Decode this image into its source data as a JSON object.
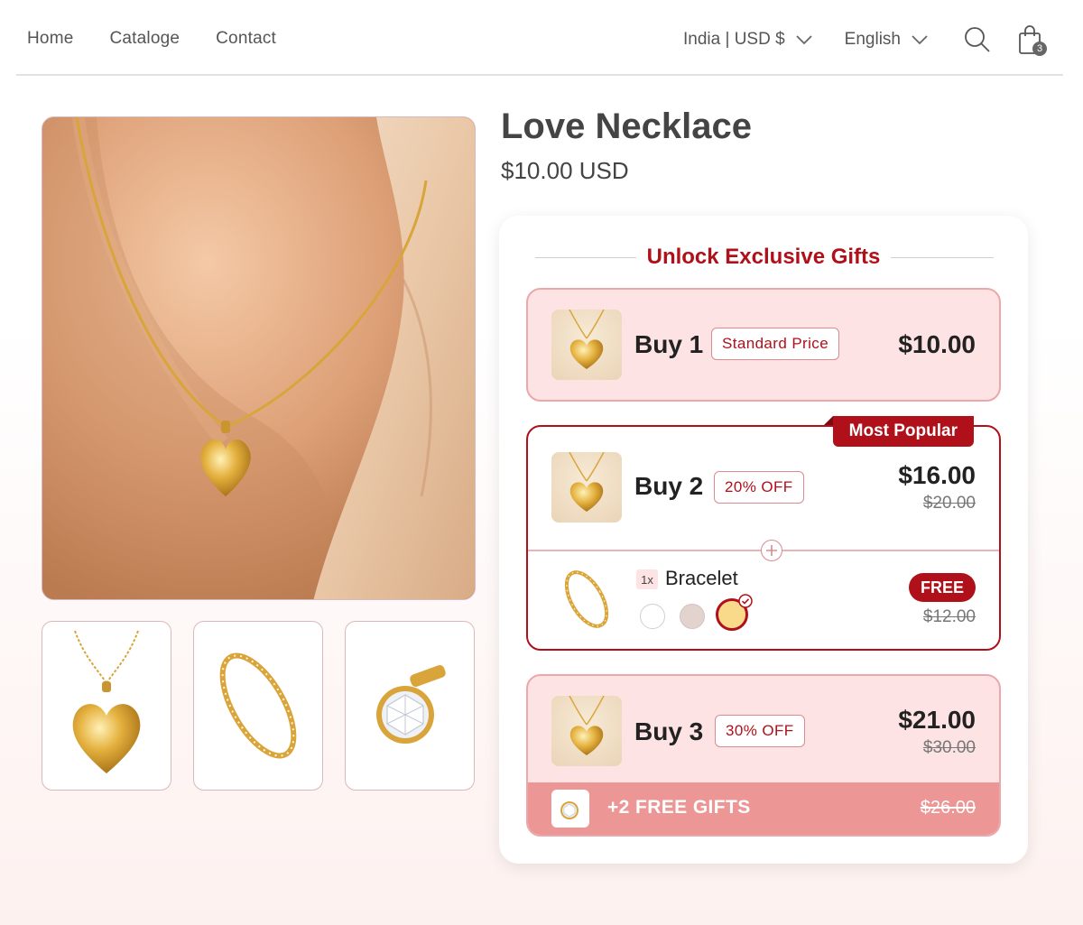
{
  "nav": {
    "items": [
      "Home",
      "Cataloge",
      "Contact"
    ]
  },
  "header": {
    "region": "India | USD $",
    "language": "English",
    "cart_count": "3",
    "icons": {
      "search": "search-icon",
      "cart": "shopping-bag-icon",
      "chevron": "chevron-down-icon"
    }
  },
  "product": {
    "title": "Love Necklace",
    "price": "$10.00 USD"
  },
  "bundle": {
    "heading": "Unlock Exclusive Gifts",
    "options": [
      {
        "label": "Buy 1",
        "tag": "Standard Price",
        "price": "$10.00"
      },
      {
        "label": "Buy 2",
        "tag": "20% OFF",
        "price": "$16.00",
        "old_price": "$20.00",
        "ribbon": "Most Popular",
        "gift": {
          "qty": "1x",
          "name": "Bracelet",
          "badge": "FREE",
          "old_price": "$12.00",
          "swatches": [
            {
              "color": "#ffffff",
              "selected": false
            },
            {
              "color": "#e3d3ce",
              "selected": false
            },
            {
              "color": "#f9d98a",
              "selected": true
            }
          ]
        }
      },
      {
        "label": "Buy 3",
        "tag": "30% OFF",
        "price": "$21.00",
        "old_price": "$30.00",
        "gift_bar": {
          "text": "+2 FREE GIFTS",
          "old_price": "$26.00"
        }
      }
    ]
  },
  "colors": {
    "accent": "#b0101a",
    "pink_bg": "#fde3e3",
    "gift_bar": "#ec9696",
    "gold": "#d9a53b"
  }
}
